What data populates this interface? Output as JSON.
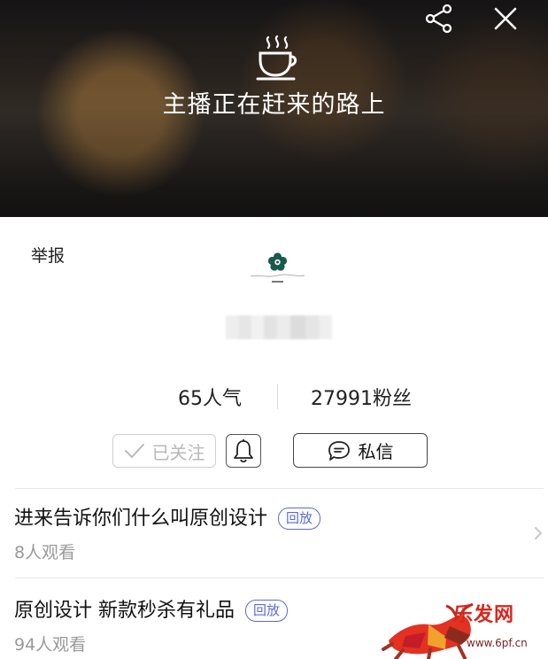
{
  "header": {
    "status_text": "主播正在赶来的路上",
    "icons": {
      "share": "share-icon",
      "close": "close-icon",
      "cup": "steaming-cup-icon"
    }
  },
  "profile": {
    "report_label": "举报",
    "popularity": "65人气",
    "fans": "27991粉丝"
  },
  "actions": {
    "followed_label": "已关注",
    "message_label": "私信",
    "icons": {
      "check": "check-icon",
      "bell": "bell-icon",
      "message": "chat-bubble-icon"
    }
  },
  "videos": [
    {
      "title": "进来告诉你们什么叫原创设计",
      "badge": "回放",
      "views": "8人观看",
      "has_chevron": true
    },
    {
      "title": "原创设计 新款秒杀有礼品",
      "badge": "回放",
      "views": "94人观看",
      "has_chevron": false
    }
  ],
  "watermark": {
    "site_name": "乐发网",
    "url": "www.6pf.cn"
  },
  "colors": {
    "accent": "#5b69d8",
    "watermark_red": "#d9271f",
    "muted_text": "#999999"
  }
}
